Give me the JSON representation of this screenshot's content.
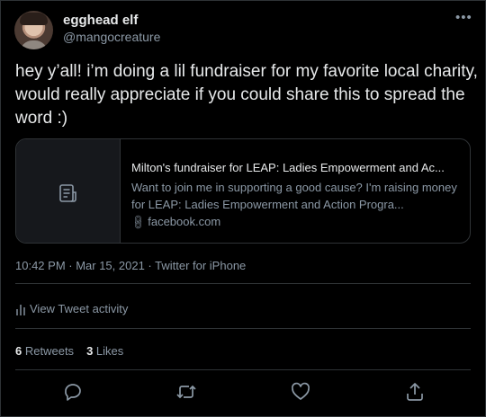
{
  "author": {
    "display_name": "egghead elf",
    "handle": "@mangocreature"
  },
  "tweet": {
    "text": "hey y’all! i’m doing a lil fundraiser for my favorite local charity, would really appreciate if you could share this to spread the word :)"
  },
  "card": {
    "title": "Milton's fundraiser for LEAP: Ladies Empowerment and Ac...",
    "description": "Want to join me in supporting a good cause? I'm raising money for LEAP: Ladies Empowerment and Action Progra...",
    "domain": "facebook.com",
    "media_icon": "document-icon"
  },
  "meta": {
    "timestamp": "10:42 PM · Mar 15, 2021 · Twitter for iPhone"
  },
  "activity": {
    "label": "View Tweet activity"
  },
  "stats": {
    "retweets_count": "6",
    "retweets_label": "Retweets",
    "likes_count": "3",
    "likes_label": "Likes"
  },
  "actions": [
    "reply-icon",
    "retweet-icon",
    "like-icon",
    "share-icon"
  ],
  "colors": {
    "background": "#000000",
    "primary_text": "#e7e9ea",
    "secondary_text": "#8b98a5",
    "border": "#2f3336"
  }
}
